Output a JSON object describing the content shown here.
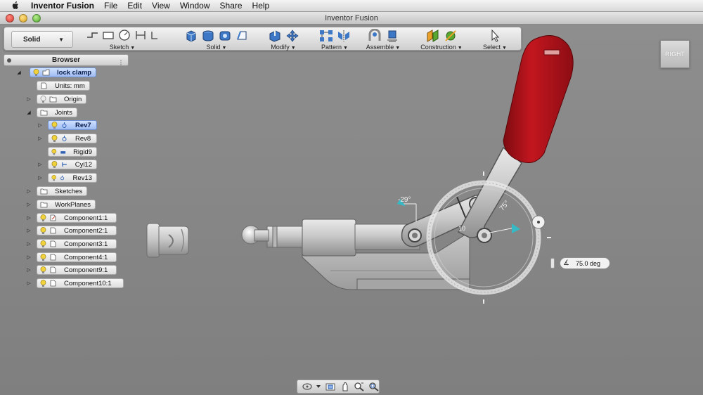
{
  "menubar": {
    "app_name": "Inventor Fusion",
    "items": [
      "File",
      "Edit",
      "View",
      "Window",
      "Share",
      "Help"
    ]
  },
  "window": {
    "title": "Inventor Fusion"
  },
  "ribbon": {
    "mode": "Solid",
    "groups": [
      {
        "label": "Sketch",
        "icons": [
          "line-icon",
          "rectangle-icon",
          "circle-icon",
          "dimension-icon",
          "project-icon"
        ]
      },
      {
        "label": "Solid",
        "icons": [
          "extrude-icon",
          "revolve-icon",
          "sweep-icon",
          "loft-icon"
        ]
      },
      {
        "label": "Modify",
        "icons": [
          "press-pull-icon",
          "move-icon"
        ]
      },
      {
        "label": "Pattern",
        "icons": [
          "rect-pattern-icon",
          "mirror-icon"
        ]
      },
      {
        "label": "Assemble",
        "icons": [
          "joint-icon",
          "ground-icon"
        ]
      },
      {
        "label": "Construction",
        "icons": [
          "plane-icon",
          "axis-icon"
        ]
      },
      {
        "label": "Select",
        "icons": [
          "pointer-icon"
        ]
      }
    ]
  },
  "browser": {
    "title": "Browser",
    "nodes": [
      {
        "label": "lock clamp",
        "selected": true
      },
      {
        "label": "Units: mm"
      },
      {
        "label": "Origin"
      },
      {
        "label": "Joints"
      },
      {
        "label": "Rev7",
        "selected": true
      },
      {
        "label": "Rev8"
      },
      {
        "label": "Rigid9"
      },
      {
        "label": "Cyl12"
      },
      {
        "label": "Rev13"
      },
      {
        "label": "Sketches"
      },
      {
        "label": "WorkPlanes"
      },
      {
        "label": "Component1:1"
      },
      {
        "label": "Component2:1"
      },
      {
        "label": "Component3:1"
      },
      {
        "label": "Component4:1"
      },
      {
        "label": "Component9:1"
      },
      {
        "label": "Component10:1"
      }
    ]
  },
  "viewcube": {
    "label": "RIGHT"
  },
  "manipulator": {
    "angle_left": "-29°",
    "angle_right": "75°",
    "angle_inner": "10",
    "angle_value": "75.0 deg"
  },
  "colors": {
    "handle_red": "#b3121b",
    "selection_blue": "#a8c4f5",
    "viewport_gray": "#878787"
  }
}
